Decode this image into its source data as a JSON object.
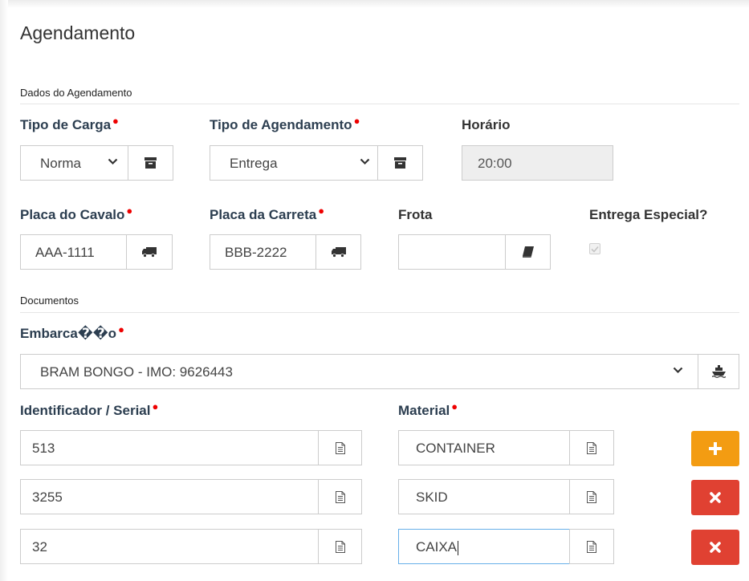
{
  "page": {
    "title": "Agendamento"
  },
  "sections": {
    "agendamento": "Dados do Agendamento",
    "documentos": "Documentos"
  },
  "fields": {
    "tipo_carga": {
      "label": "Tipo de Carga",
      "value": "Norma"
    },
    "tipo_agendamento": {
      "label": "Tipo de Agendamento",
      "value": "Entrega"
    },
    "horario": {
      "label": "Horário",
      "value": "20:00"
    },
    "placa_cavalo": {
      "label": "Placa do Cavalo",
      "value": "AAA-1111"
    },
    "placa_carreta": {
      "label": "Placa da Carreta",
      "value": "BBB-2222"
    },
    "frota": {
      "label": "Frota",
      "value": ""
    },
    "entrega_especial": {
      "label": "Entrega Especial?",
      "checked": true
    },
    "embarcacao": {
      "label": "Embarca��o",
      "value": "BRAM BONGO - IMO: 9626443"
    },
    "identificador": {
      "label": "Identificador / Serial"
    },
    "material": {
      "label": "Material"
    }
  },
  "rows": [
    {
      "serial": "513",
      "material": "CONTAINER",
      "action": "add"
    },
    {
      "serial": "3255",
      "material": "SKID",
      "action": "delete"
    },
    {
      "serial": "32",
      "material": "CAIXA",
      "action": "delete"
    }
  ],
  "icons": {
    "archive": "archive-icon",
    "truck": "truck-icon",
    "book": "book-icon",
    "ship": "ship-icon",
    "file": "file-text-icon",
    "plus": "plus-icon",
    "times": "times-icon"
  },
  "colors": {
    "required": "#e00000",
    "add": "#f39c12",
    "delete": "#e04132",
    "focus": "#66afe9"
  }
}
